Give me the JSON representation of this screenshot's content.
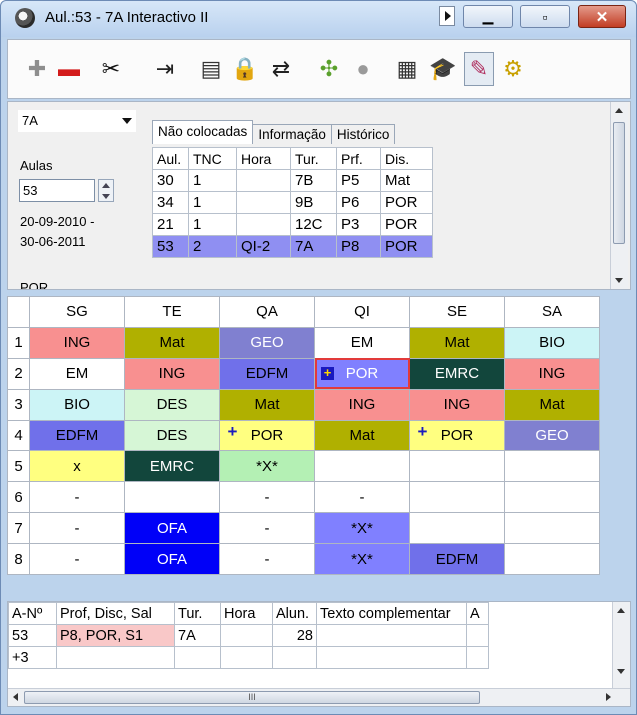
{
  "window": {
    "title": "Aul.:53 - 7A  Interactivo II",
    "close_glyph": "✕",
    "min_glyph": "▁",
    "max_glyph": "▫"
  },
  "toolbar": {
    "tools": [
      {
        "name": "add-icon",
        "glyph": "✚",
        "color": "#8e8e8e"
      },
      {
        "name": "remove-icon",
        "glyph": "▬",
        "color": "#d31b1b"
      },
      {
        "name": "cut-icon",
        "glyph": "✂",
        "color": "#111111"
      },
      {
        "name": "exit-icon",
        "glyph": "⇥",
        "color": "#222222"
      },
      {
        "name": "list-icon",
        "glyph": "▤",
        "color": "#333333"
      },
      {
        "name": "lock-icon",
        "glyph": "🔒",
        "color": "#c79a00"
      },
      {
        "name": "swap-icon",
        "glyph": "⇄",
        "color": "#222222"
      },
      {
        "name": "puzzle-icon",
        "glyph": "✣",
        "color": "#5aa02c"
      },
      {
        "name": "circle-icon",
        "glyph": "●",
        "color": "#9a9a9a"
      },
      {
        "name": "calculator-icon",
        "glyph": "▦",
        "color": "#333333"
      },
      {
        "name": "graduation-icon",
        "glyph": "🎓",
        "color": "#111111"
      },
      {
        "name": "pencil-cup-icon",
        "glyph": "✎",
        "color": "#b03060"
      },
      {
        "name": "gears-icon",
        "glyph": "⚙",
        "color": "#c8a000"
      }
    ]
  },
  "left_panel": {
    "class_select": "7A",
    "aulas_label": "Aulas",
    "aula_value": "53",
    "date_from": "20-09-2010 -",
    "date_to": "30-06-2011",
    "cut_text": "POR"
  },
  "tabs": [
    "Não colocadas",
    "Informação",
    "Histórico"
  ],
  "lessons": {
    "headers": [
      "Aul.",
      "TNC",
      "Hora",
      "Tur.",
      "Prf.",
      "Dis."
    ],
    "rows": [
      [
        "30",
        "1",
        "",
        "7B",
        "P5",
        "Mat"
      ],
      [
        "34",
        "1",
        "",
        "9B",
        "P6",
        "POR"
      ],
      [
        "21",
        "1",
        "",
        "12C",
        "P3",
        "POR"
      ],
      [
        "53",
        "2",
        "QI-2",
        "7A",
        "P8",
        "POR"
      ]
    ]
  },
  "timetable": {
    "days": [
      "SG",
      "TE",
      "QA",
      "QI",
      "SE",
      "SA"
    ],
    "rows": [
      {
        "n": "1",
        "cells": [
          {
            "t": "ING",
            "bg": "#f89090",
            "fg": "#000"
          },
          {
            "t": "Mat",
            "bg": "#b0b000",
            "fg": "#000"
          },
          {
            "t": "GEO",
            "bg": "#8080d0",
            "fg": "#fff"
          },
          {
            "t": "EM",
            "bg": "#ffffff",
            "fg": "#000"
          },
          {
            "t": "Mat",
            "bg": "#b0b000",
            "fg": "#000"
          },
          {
            "t": "BIO",
            "bg": "#ccf4f6",
            "fg": "#000"
          }
        ]
      },
      {
        "n": "2",
        "cells": [
          {
            "t": "EM",
            "bg": "#ffffff",
            "fg": "#000"
          },
          {
            "t": "ING",
            "bg": "#f89090",
            "fg": "#000"
          },
          {
            "t": "EDFM",
            "bg": "#7070ea",
            "fg": "#000"
          },
          {
            "t": "POR",
            "bg": "#8080ff",
            "fg": "#fff",
            "plus": true,
            "selected": true
          },
          {
            "t": "EMRC",
            "bg": "#12463c",
            "fg": "#fff"
          },
          {
            "t": "ING",
            "bg": "#f89090",
            "fg": "#000"
          }
        ]
      },
      {
        "n": "3",
        "cells": [
          {
            "t": "BIO",
            "bg": "#ccf4f6",
            "fg": "#000"
          },
          {
            "t": "DES",
            "bg": "#d6f6d6",
            "fg": "#000"
          },
          {
            "t": "Mat",
            "bg": "#b0b000",
            "fg": "#000"
          },
          {
            "t": "ING",
            "bg": "#f89090",
            "fg": "#000"
          },
          {
            "t": "ING",
            "bg": "#f89090",
            "fg": "#000"
          },
          {
            "t": "Mat",
            "bg": "#b0b000",
            "fg": "#000"
          }
        ]
      },
      {
        "n": "4",
        "cells": [
          {
            "t": "EDFM",
            "bg": "#7070ea",
            "fg": "#000"
          },
          {
            "t": "DES",
            "bg": "#d6f6d6",
            "fg": "#000"
          },
          {
            "t": "POR",
            "bg": "#ffff80",
            "fg": "#000",
            "plus": true
          },
          {
            "t": "Mat",
            "bg": "#b0b000",
            "fg": "#000"
          },
          {
            "t": "POR",
            "bg": "#ffff80",
            "fg": "#000",
            "plus": true
          },
          {
            "t": "GEO",
            "bg": "#8080d0",
            "fg": "#fff"
          }
        ]
      },
      {
        "n": "5",
        "cells": [
          {
            "t": "x",
            "bg": "#ffff80",
            "fg": "#000"
          },
          {
            "t": "EMRC",
            "bg": "#12463c",
            "fg": "#fff"
          },
          {
            "t": "*X*",
            "bg": "#b4f0b4",
            "fg": "#000"
          },
          {
            "t": "",
            "bg": "#ffffff",
            "fg": "#000"
          },
          {
            "t": "",
            "bg": "#ffffff",
            "fg": "#000"
          },
          {
            "t": "",
            "bg": "#ffffff",
            "fg": "#000"
          }
        ]
      },
      {
        "n": "6",
        "cells": [
          {
            "t": "-",
            "bg": "#ffffff",
            "fg": "#000"
          },
          {
            "t": "",
            "bg": "#ffffff",
            "fg": "#000"
          },
          {
            "t": "-",
            "bg": "#ffffff",
            "fg": "#000"
          },
          {
            "t": "-",
            "bg": "#ffffff",
            "fg": "#000"
          },
          {
            "t": "",
            "bg": "#ffffff",
            "fg": "#000"
          },
          {
            "t": "",
            "bg": "#ffffff",
            "fg": "#000"
          }
        ]
      },
      {
        "n": "7",
        "cells": [
          {
            "t": "-",
            "bg": "#ffffff",
            "fg": "#000"
          },
          {
            "t": "OFA",
            "bg": "#0000f8",
            "fg": "#fff"
          },
          {
            "t": "-",
            "bg": "#ffffff",
            "fg": "#000"
          },
          {
            "t": "*X*",
            "bg": "#8080ff",
            "fg": "#000"
          },
          {
            "t": "",
            "bg": "#ffffff",
            "fg": "#000"
          },
          {
            "t": "",
            "bg": "#ffffff",
            "fg": "#000"
          }
        ]
      },
      {
        "n": "8",
        "cells": [
          {
            "t": "-",
            "bg": "#ffffff",
            "fg": "#000"
          },
          {
            "t": "OFA",
            "bg": "#0000f8",
            "fg": "#fff"
          },
          {
            "t": "-",
            "bg": "#ffffff",
            "fg": "#000"
          },
          {
            "t": "*X*",
            "bg": "#8080ff",
            "fg": "#000"
          },
          {
            "t": "EDFM",
            "bg": "#7070ea",
            "fg": "#000"
          },
          {
            "t": "",
            "bg": "#ffffff",
            "fg": "#000"
          }
        ]
      }
    ]
  },
  "groups": {
    "headers": [
      "A-Nº",
      "Prof, Disc, Sal",
      "Tur.",
      "Hora",
      "Alun.",
      "Texto complementar",
      "A"
    ],
    "rows": [
      [
        "53",
        "P8, POR, S1",
        "7A",
        "",
        "28",
        "",
        ""
      ],
      [
        "+3",
        "",
        "",
        "",
        "",
        "",
        ""
      ]
    ]
  },
  "hscroll_grip": "III"
}
